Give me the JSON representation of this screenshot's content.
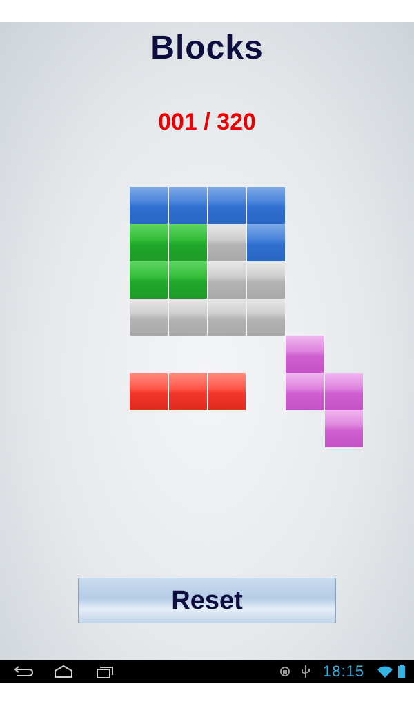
{
  "title": "Blocks",
  "level_text": "001 / 320",
  "reset_label": "Reset",
  "status": {
    "clock": "18:15"
  },
  "colors": {
    "blue": "#3474d4",
    "green": "#2db532",
    "gray": "#bdbdbd",
    "red": "#f03a2e",
    "purple": "#d26ad2",
    "title": "#0d0d40",
    "level": "#ee0000",
    "clock": "#33b5e5"
  },
  "board": {
    "cells": [
      {
        "row": 0,
        "col": 0,
        "color": "blue"
      },
      {
        "row": 0,
        "col": 1,
        "color": "blue"
      },
      {
        "row": 0,
        "col": 2,
        "color": "blue"
      },
      {
        "row": 0,
        "col": 3,
        "color": "blue"
      },
      {
        "row": 1,
        "col": 0,
        "color": "green"
      },
      {
        "row": 1,
        "col": 1,
        "color": "green"
      },
      {
        "row": 1,
        "col": 2,
        "color": "gray"
      },
      {
        "row": 1,
        "col": 3,
        "color": "blue"
      },
      {
        "row": 2,
        "col": 0,
        "color": "green"
      },
      {
        "row": 2,
        "col": 1,
        "color": "green"
      },
      {
        "row": 2,
        "col": 2,
        "color": "gray"
      },
      {
        "row": 2,
        "col": 3,
        "color": "gray"
      },
      {
        "row": 3,
        "col": 0,
        "color": "gray"
      },
      {
        "row": 3,
        "col": 1,
        "color": "gray"
      },
      {
        "row": 3,
        "col": 2,
        "color": "gray"
      },
      {
        "row": 3,
        "col": 3,
        "color": "gray"
      },
      {
        "row": 4,
        "col": 4,
        "color": "purple"
      },
      {
        "row": 5,
        "col": 0,
        "color": "red"
      },
      {
        "row": 5,
        "col": 1,
        "color": "red"
      },
      {
        "row": 5,
        "col": 2,
        "color": "red"
      },
      {
        "row": 5,
        "col": 4,
        "color": "purple"
      },
      {
        "row": 5,
        "col": 5,
        "color": "purple"
      },
      {
        "row": 6,
        "col": 5,
        "color": "purple"
      }
    ]
  },
  "nav_icons": [
    "back-icon",
    "home-icon",
    "recent-apps-icon"
  ],
  "status_icons": [
    "android-debug-icon",
    "usb-icon",
    "wifi-icon",
    "battery-icon"
  ]
}
